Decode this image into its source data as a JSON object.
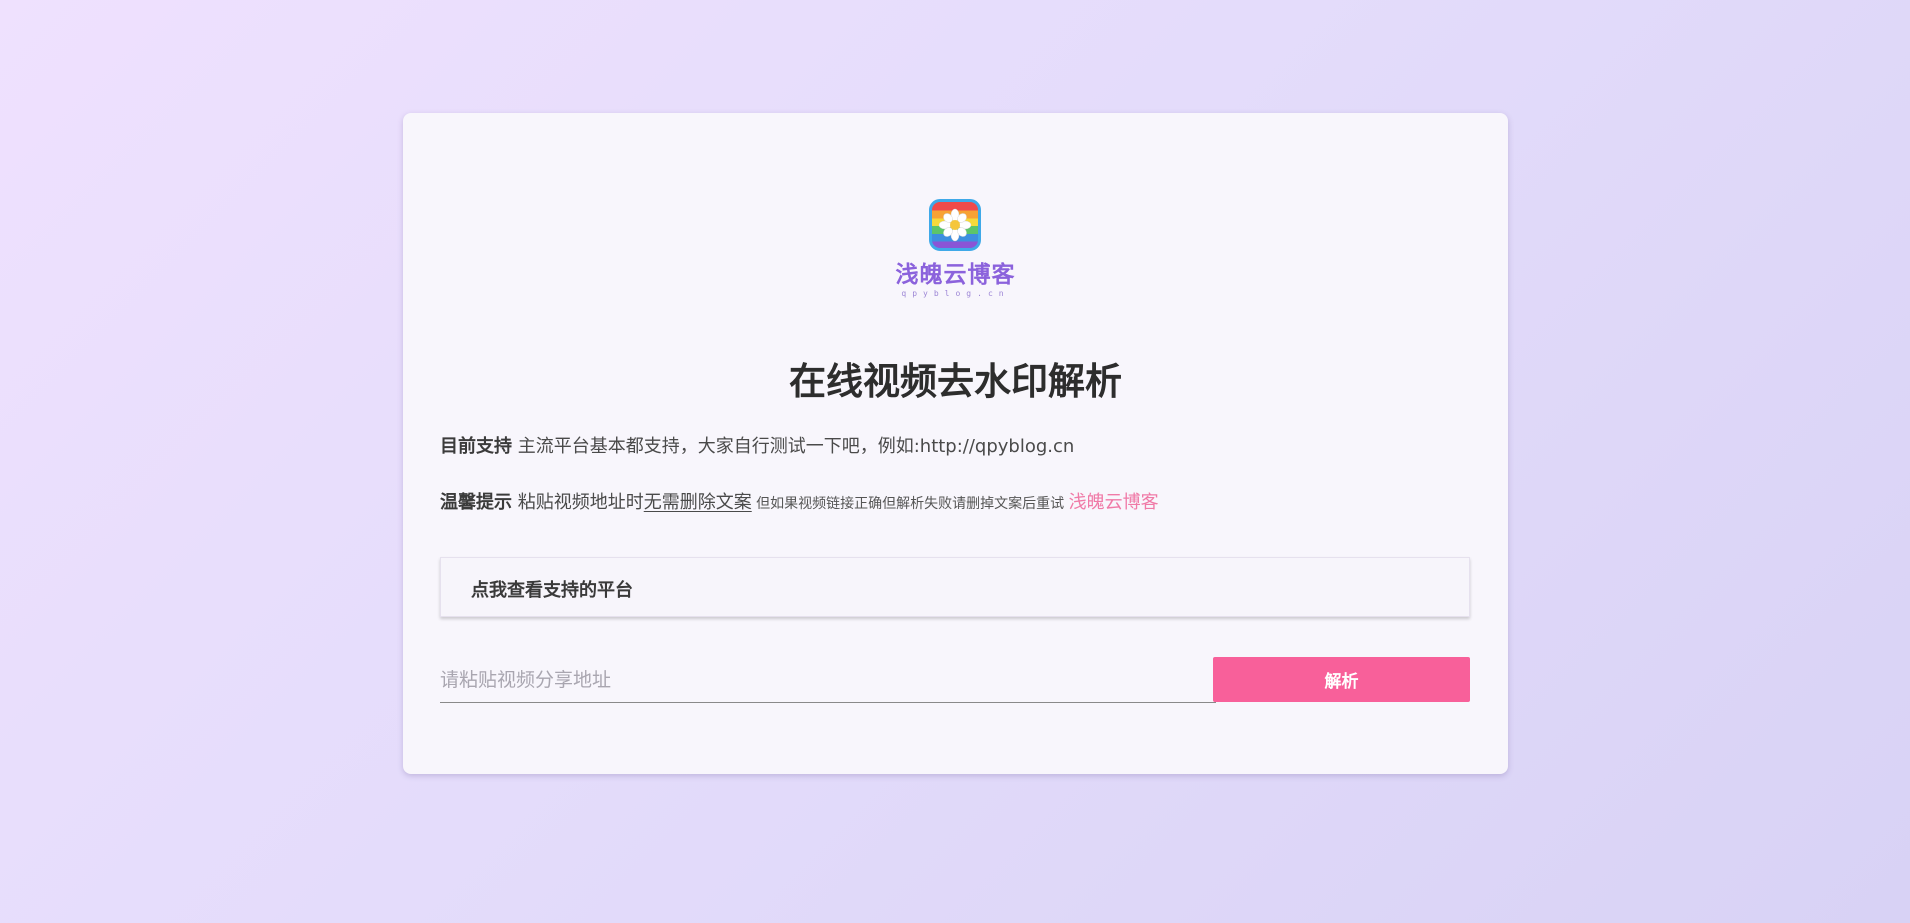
{
  "logo": {
    "text": "浅魄云博客",
    "subtext": "qpyblog.cn"
  },
  "title": "在线视频去水印解析",
  "support": {
    "label": "目前支持",
    "text": " 主流平台基本都支持，大家自行测试一下吧，例如:http://qpyblog.cn"
  },
  "tip": {
    "label": "温馨提示",
    "text_before": " 粘贴视频地址时",
    "underlined": "无需删除文案",
    "small_text": " 但如果视频链接正确但解析失败请删掉文案后重试 ",
    "link": "浅魄云博客"
  },
  "platforms_toggle": "点我查看支持的平台",
  "input": {
    "placeholder": "请粘贴视频分享地址",
    "value": ""
  },
  "parse_button": "解析",
  "colors": {
    "accent": "#f8609a",
    "link": "#f07aa7",
    "logo": "#8b62dc"
  }
}
